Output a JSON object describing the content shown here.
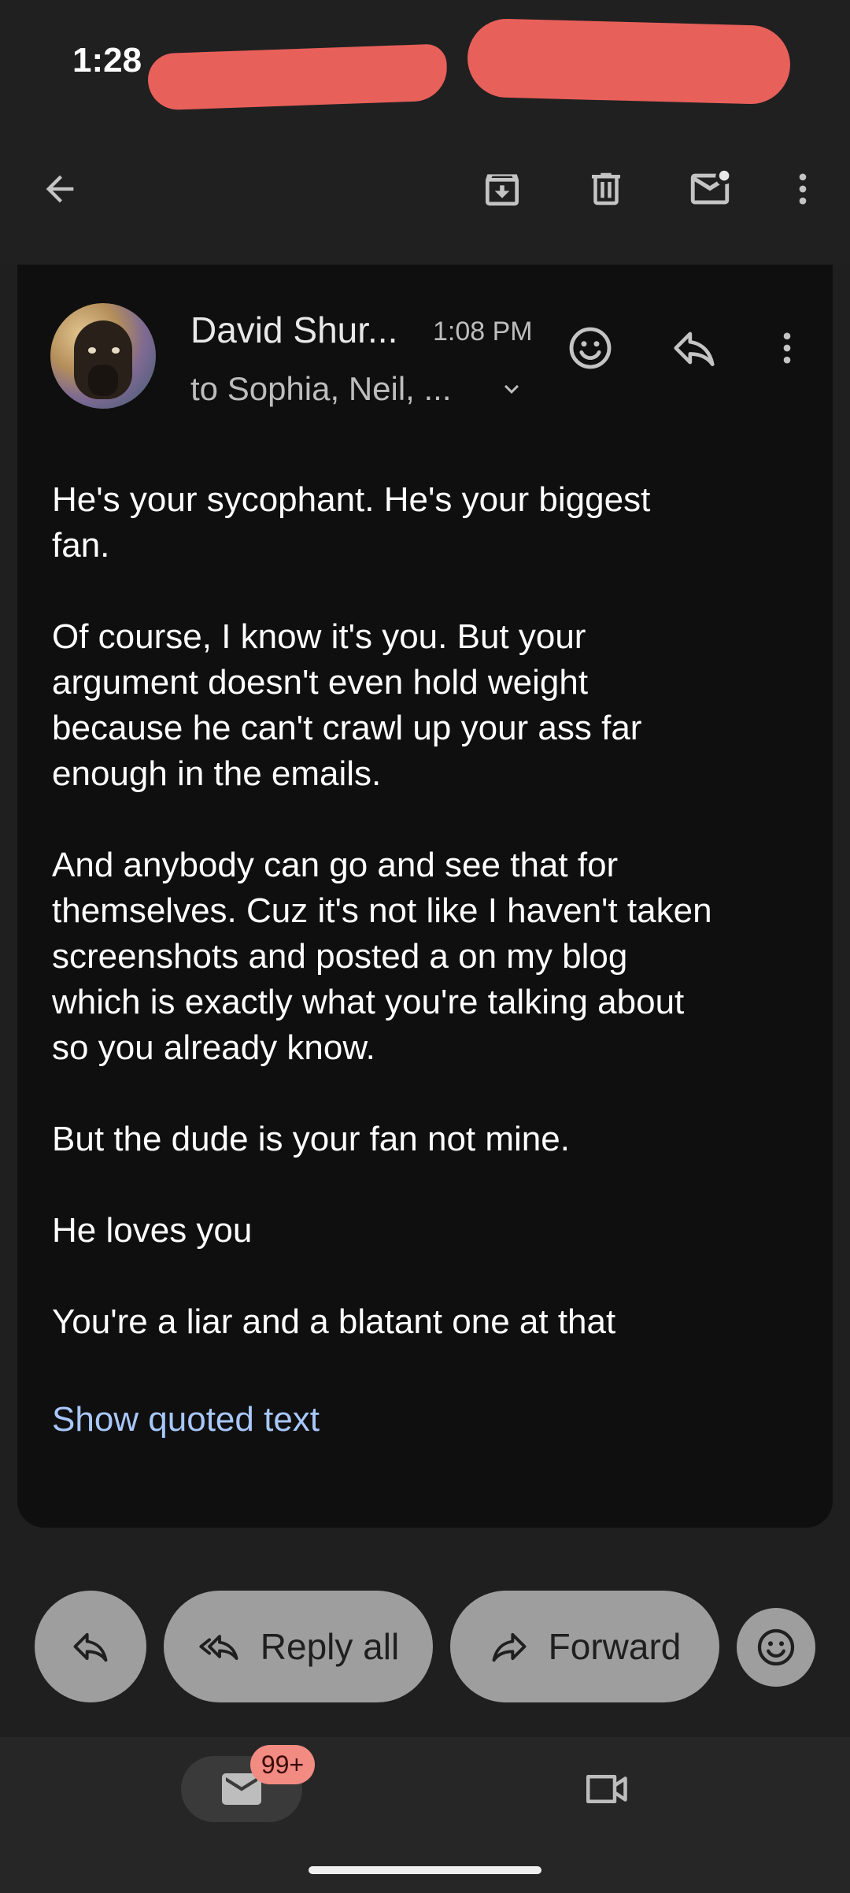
{
  "status_bar": {
    "time": "1:28"
  },
  "toolbar": {
    "back_icon": "arrow-back-icon",
    "archive_icon": "archive-icon",
    "delete_icon": "trash-icon",
    "mark_unread_icon": "mark-unread-icon",
    "more_icon": "more-vert-icon"
  },
  "message": {
    "sender": "David Shur...",
    "time": "1:08 PM",
    "recipients": "to Sophia, Neil, ...",
    "paragraphs": [
      "He's your sycophant. He's your biggest\nfan.",
      "Of course, I know it's you. But your\nargument doesn't even hold weight\nbecause he can't crawl up your ass far\nenough in the emails.",
      "And anybody can go and see that for\nthemselves. Cuz it's not like I haven't taken\nscreenshots and posted a on my blog\nwhich is exactly what you're talking about\nso you already know.",
      "But the dude is your fan not mine.",
      "He loves you",
      "You're a liar and a blatant one at that"
    ],
    "show_quoted": "Show quoted text"
  },
  "actions": {
    "reply_all": "Reply all",
    "forward": "Forward"
  },
  "bottom_nav": {
    "mail_badge": "99+"
  },
  "colors": {
    "background": "#1f1f1f",
    "card": "#0f0f0f",
    "link": "#a8c7fa",
    "pill": "#9e9e9e",
    "badge": "#f28b82"
  }
}
